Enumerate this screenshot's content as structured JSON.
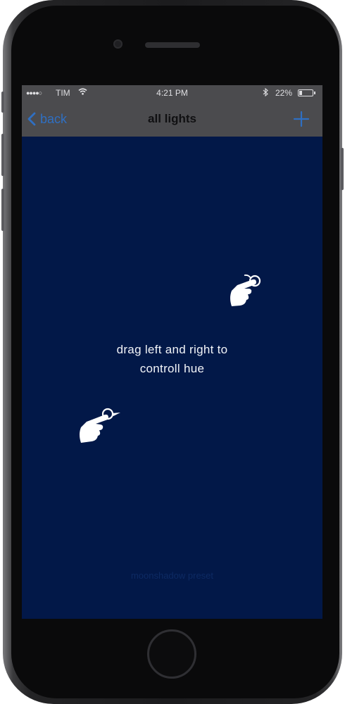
{
  "status_bar": {
    "signal": "●●●●○",
    "carrier": "TIM",
    "time": "4:21 PM",
    "battery": "22%",
    "battery_level": 0.22
  },
  "nav": {
    "back_label": "back",
    "title": "all lights",
    "add_icon": "plus-icon"
  },
  "content": {
    "hint_line1": "drag left and right to",
    "hint_line2": "controll hue",
    "preset_label": "moonshadow preset",
    "gesture_icons": [
      "swipe-right-hand-icon",
      "swipe-left-hand-icon"
    ]
  },
  "colors": {
    "background": "#021848",
    "bar": "#4b4b4e",
    "accent": "#2f6fc2",
    "text": "#f2f4f8"
  }
}
